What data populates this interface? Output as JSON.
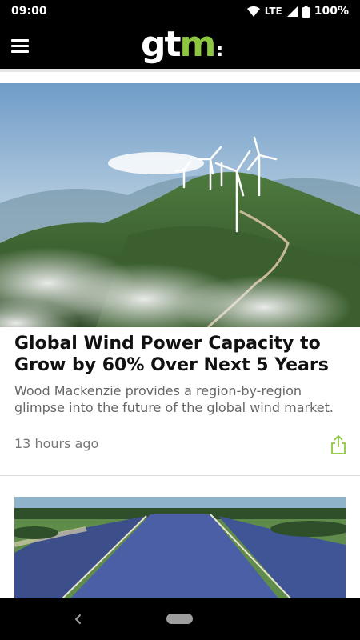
{
  "status_bar": {
    "time": "09:00",
    "network": "LTE",
    "battery": "100%"
  },
  "app_bar": {
    "logo_prefix": "gt",
    "logo_suffix": "m",
    "logo_colon": ":"
  },
  "articles": [
    {
      "title": "Global Wind Power Capacity to Grow by 60% Over Next 5 Years",
      "summary": "Wood Mackenzie provides a region-by-region glimpse into the future of the global wind market.",
      "time": "13 hours ago"
    }
  ],
  "icons": {
    "menu": "hamburger-menu-icon",
    "share": "share-icon",
    "back": "back-icon",
    "home": "home-pill-icon",
    "wifi": "wifi-icon",
    "signal": "signal-icon",
    "battery": "battery-icon"
  },
  "colors": {
    "brand_green": "#8dc63f",
    "bar_background": "#000000"
  }
}
